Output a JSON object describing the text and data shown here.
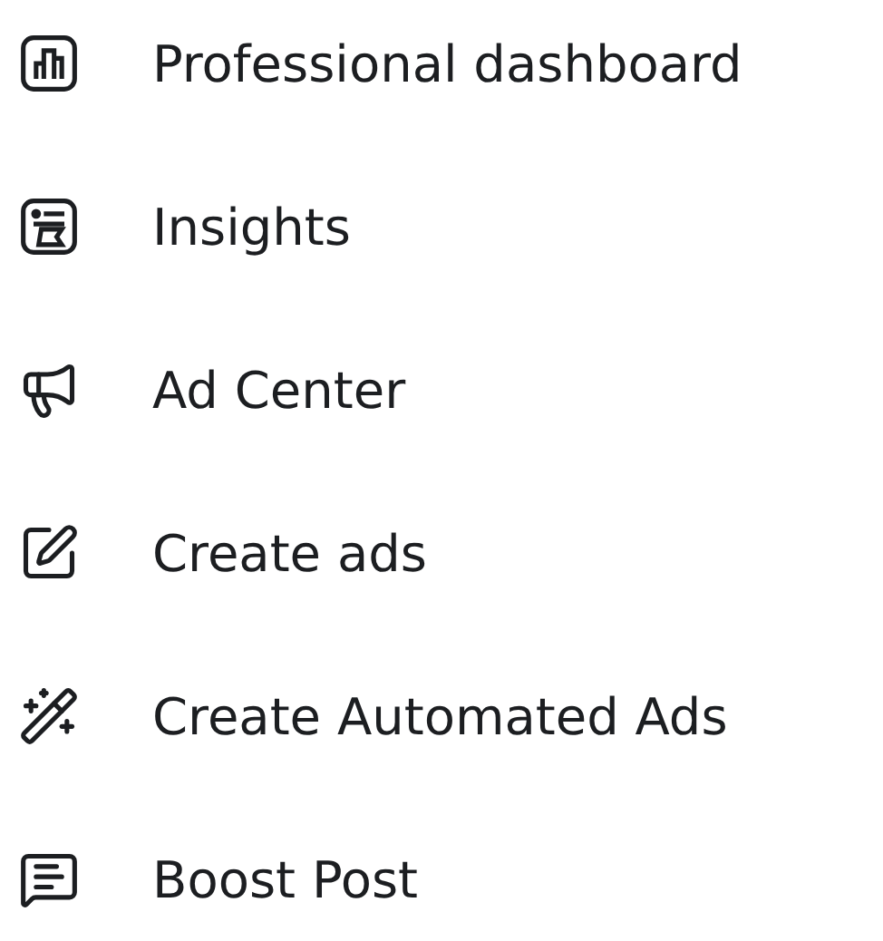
{
  "menu": {
    "items": [
      {
        "label": "Professional dashboard"
      },
      {
        "label": "Insights"
      },
      {
        "label": "Ad Center"
      },
      {
        "label": "Create ads"
      },
      {
        "label": "Create Automated Ads"
      },
      {
        "label": "Boost Post"
      }
    ]
  }
}
